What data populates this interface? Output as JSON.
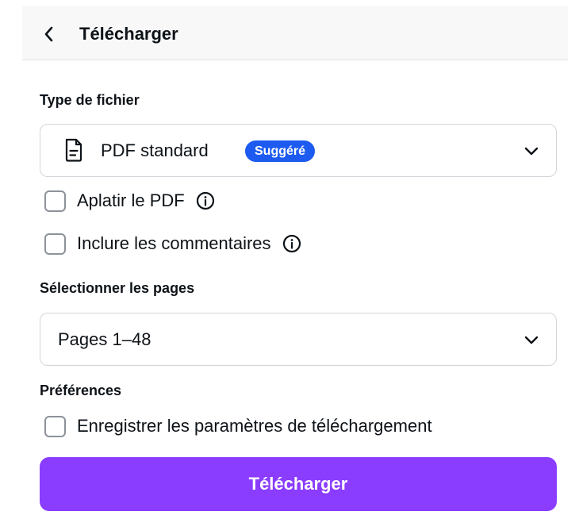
{
  "header": {
    "back_icon": "chevron-left-icon",
    "title": "Télécharger"
  },
  "file_type": {
    "label": "Type de fichier",
    "selected": "PDF standard",
    "icon": "document-icon",
    "badge": "Suggéré",
    "badge_color": "#1d5bf0"
  },
  "options": {
    "flatten_pdf": {
      "label": "Aplatir le PDF",
      "checked": false
    },
    "include_comments": {
      "label": "Inclure les commentaires",
      "checked": false
    }
  },
  "pages": {
    "label": "Sélectionner les pages",
    "selected": "Pages 1–48"
  },
  "preferences": {
    "label": "Préférences",
    "save_settings": {
      "label": "Enregistrer les paramètres de téléchargement",
      "checked": false
    }
  },
  "download_button": {
    "label": "Télécharger",
    "color": "#8b3dff"
  }
}
